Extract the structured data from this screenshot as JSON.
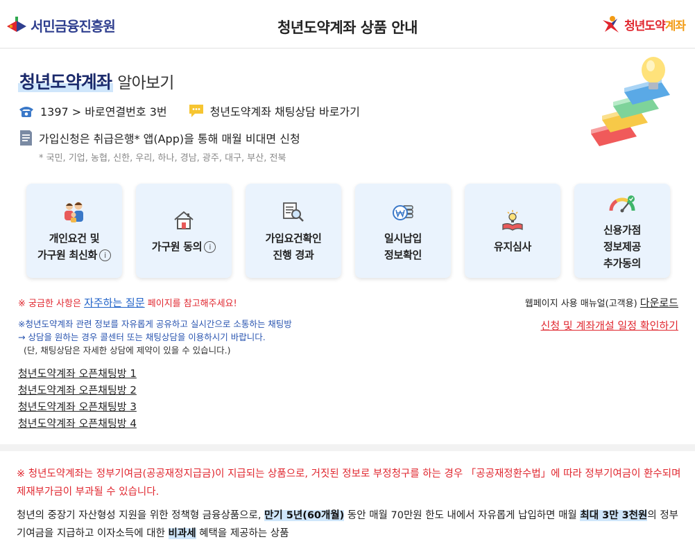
{
  "header": {
    "org_logo_text": "서민금융진흥원",
    "title": "청년도약계좌 상품 안내",
    "product_logo_text_a": "청년도약",
    "product_logo_text_b": "계좌"
  },
  "intro": {
    "title_highlight": "청년도약계좌",
    "title_rest": "알아보기",
    "phone_text": "1397 > 바로연결번호 3번",
    "chat_link": "청년도약계좌 채팅상담 바로가기",
    "apply_text": "가입신청은 취급은행* 앱(App)을 통해 매월 비대면 신청",
    "banks_note": "* 국민, 기업, 농협, 신한, 우리, 하나, 경남, 광주, 대구, 부산, 전북"
  },
  "cards": [
    {
      "label_1": "개인요건 및",
      "label_2": "가구원 최신화",
      "icon": "family-icon"
    },
    {
      "label_1": "가구원 동의",
      "icon": "house-icon"
    },
    {
      "label_1": "가입요건확인",
      "label_2": "진행 경과",
      "icon": "document-search-icon"
    },
    {
      "label_1": "일시납입",
      "label_2": "정보확인",
      "icon": "won-coin-icon"
    },
    {
      "label_1": "유지심사",
      "icon": "book-lamp-icon"
    },
    {
      "label_1": "신용가점",
      "label_2": "정보제공",
      "label_3": "추가동의",
      "icon": "gauge-icon"
    }
  ],
  "info_symbol": "i",
  "notices": {
    "faq_prefix": "※ 궁금한 사항은 ",
    "faq_link": "자주하는 질문",
    "faq_suffix": " 페이지를 참고해주세요!",
    "manual_prefix": "웹페이지 사용 매뉴얼(고객용) ",
    "manual_link": "다운로드",
    "schedule_link": "신청 및 계좌개설 일정 확인하기",
    "chat_line1": "※청년도약계좌 관련 정보를 자유롭게 공유하고 실시간으로 소통하는 채팅방",
    "chat_line2": "→ 상담을 원하는 경우 콜센터 또는 채팅상담을 이용하시기 바랍니다.",
    "chat_line3": "(단, 채팅상담은 자세한 상담에 제약이 있을 수 있습니다.)"
  },
  "chatrooms": [
    "청년도약계좌 오픈채팅방 1",
    "청년도약계좌 오픈채팅방 2",
    "청년도약계좌 오픈채팅방 3",
    "청년도약계좌 오픈채팅방 4"
  ],
  "warning": "※ 청년도약계좌는 정부기여금(공공재정지급금)이 지급되는 상품으로, 거짓된 정보로 부정청구를 하는 경우 「공공재정환수법」에 따라 정부기여금이 환수되며 제재부가금이 부과될 수 있습니다.",
  "description": {
    "part1": "청년의 중장기 자산형성 지원을 위한 정책형 금융상품으로, ",
    "hl1": "만기 5년(60개월)",
    "part2": " 동안 매월 70만원 한도 내에서 자유롭게 납입하면 매월 ",
    "hl2": "최대 3만 3천원",
    "part3": "의 정부기여금을 지급하고 이자소득에 대한 ",
    "hl3": "비과세",
    "part4": " 혜택을 제공하는 상품"
  },
  "colors": {
    "brand_navy": "#1b2a6b",
    "alert_red": "#e0262e",
    "link_blue": "#2062c8",
    "card_bg": "#eaf3fd",
    "highlight": "#cfe6fb"
  }
}
